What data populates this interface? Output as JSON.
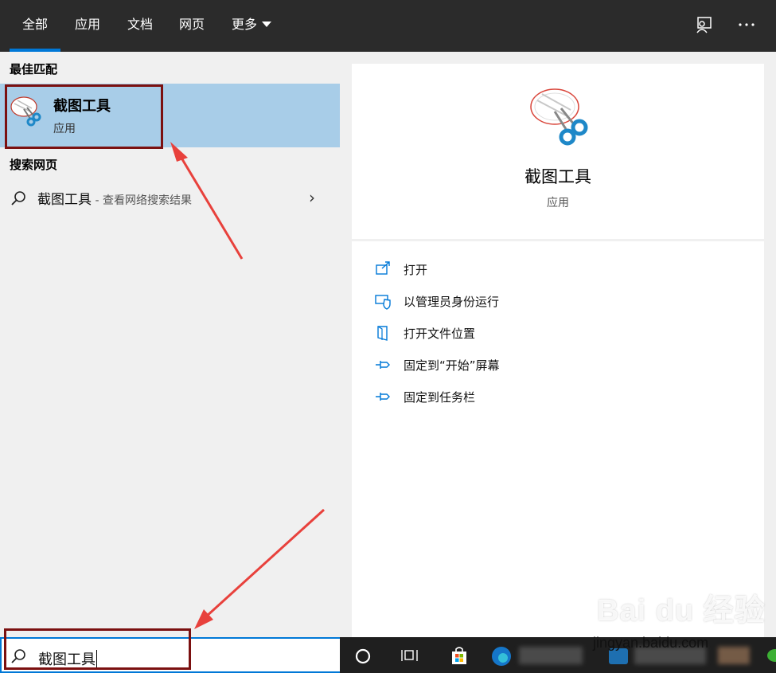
{
  "tabs": {
    "all": "全部",
    "apps": "应用",
    "docs": "文档",
    "web": "网页",
    "more": "更多"
  },
  "left": {
    "best_match_title": "最佳匹配",
    "best_match": {
      "name": "截图工具",
      "type": "应用"
    },
    "web_search_title": "搜索网页",
    "web_result": {
      "query": "截图工具",
      "hint": " - 查看网络搜索结果"
    }
  },
  "detail": {
    "name": "截图工具",
    "type": "应用",
    "actions": [
      {
        "label": "打开",
        "icon": "open-icon"
      },
      {
        "label": "以管理员身份运行",
        "icon": "shield-icon"
      },
      {
        "label": "打开文件位置",
        "icon": "file-location-icon"
      },
      {
        "label": "固定到“开始”屏幕",
        "icon": "pin-icon"
      },
      {
        "label": "固定到任务栏",
        "icon": "pin-icon"
      }
    ]
  },
  "search": {
    "value": "截图工具"
  },
  "watermark": {
    "logo": "Bai du 经验",
    "site": "jingyan.baidu.com"
  },
  "colors": {
    "accent": "#0078d7",
    "selection": "#a8cde8",
    "topbar": "#2b2b2b",
    "annotation_box": "#7b1010",
    "annotation_arrow": "#e8413c"
  }
}
